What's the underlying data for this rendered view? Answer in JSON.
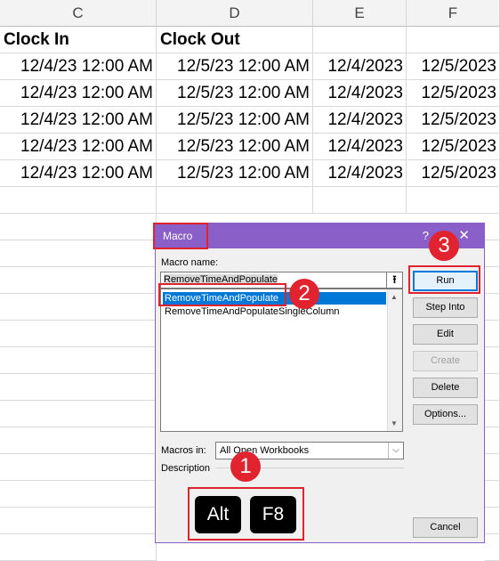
{
  "columns": [
    "C",
    "D",
    "E",
    "F"
  ],
  "headers": {
    "c": "Clock In",
    "d": "Clock Out"
  },
  "rows": [
    {
      "c": "12/4/23 12:00 AM",
      "d": "12/5/23 12:00 AM",
      "e": "12/4/2023",
      "f": "12/5/2023"
    },
    {
      "c": "12/4/23 12:00 AM",
      "d": "12/5/23 12:00 AM",
      "e": "12/4/2023",
      "f": "12/5/2023"
    },
    {
      "c": "12/4/23 12:00 AM",
      "d": "12/5/23 12:00 AM",
      "e": "12/4/2023",
      "f": "12/5/2023"
    },
    {
      "c": "12/4/23 12:00 AM",
      "d": "12/5/23 12:00 AM",
      "e": "12/4/2023",
      "f": "12/5/2023"
    },
    {
      "c": "12/4/23 12:00 AM",
      "d": "12/5/23 12:00 AM",
      "e": "12/4/2023",
      "f": "12/5/2023"
    }
  ],
  "dialog": {
    "title": "Macro",
    "help": "?",
    "close": "✕",
    "macro_name_label": "Macro name:",
    "macro_name_value": "RemoveTimeAndPopulate",
    "upload_icon": "⭱",
    "list": [
      "RemoveTimeAndPopulate",
      "RemoveTimeAndPopulateSingleColumn"
    ],
    "macros_in_label": "Macros in:",
    "macros_in_value": "All Open Workbooks",
    "description_label": "Description",
    "buttons": {
      "run": "Run",
      "step_into": "Step Into",
      "edit": "Edit",
      "create": "Create",
      "delete": "Delete",
      "options": "Options...",
      "cancel": "Cancel"
    }
  },
  "annotations": {
    "badge1": "1",
    "badge2": "2",
    "badge3": "3",
    "key_alt": "Alt",
    "key_f8": "F8"
  },
  "colors": {
    "accent": "#8a5fc8",
    "highlight": "#e0232e",
    "selection": "#0078d7"
  }
}
